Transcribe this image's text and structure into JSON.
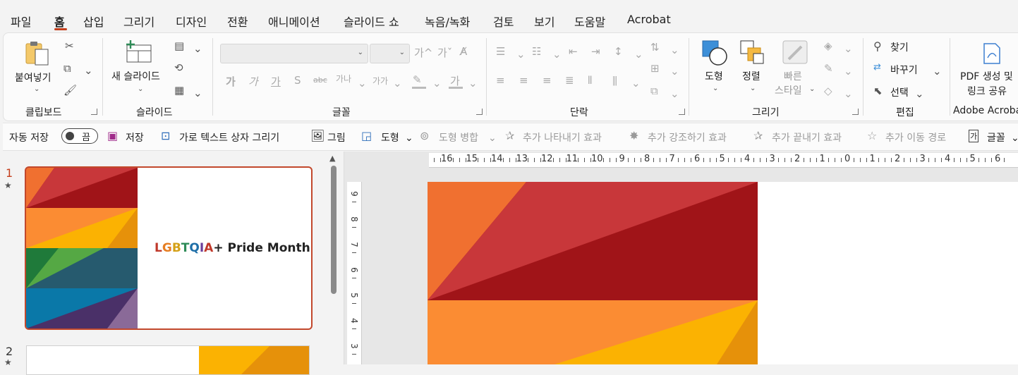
{
  "menu": {
    "tabs": [
      "파일",
      "홈",
      "삽입",
      "그리기",
      "디자인",
      "전환",
      "애니메이션",
      "슬라이드 쇼",
      "녹음/녹화",
      "검토",
      "보기",
      "도움말",
      "Acrobat"
    ],
    "active_tab": "홈"
  },
  "ribbon": {
    "clipboard": {
      "paste_label": "붙여넣기",
      "group_label": "클립보드"
    },
    "slides": {
      "new_slide_label": "새 슬라이드",
      "group_label": "슬라이드"
    },
    "font": {
      "group_label": "글꼴",
      "increase_font": "가^",
      "decrease_font": "가ˇ",
      "format_buttons": [
        "가",
        "가",
        "가",
        "S",
        "abc",
        "가나",
        "가가"
      ],
      "highlight_glyph": "가"
    },
    "paragraph": {
      "group_label": "단락"
    },
    "drawing": {
      "shapes_label": "도형",
      "arrange_label": "정렬",
      "quick_styles_label_1": "빠른",
      "quick_styles_label_2": "스타일",
      "group_label": "그리기"
    },
    "editing": {
      "find_label": "찾기",
      "replace_label": "바꾸기",
      "select_label": "선택",
      "group_label": "편집"
    },
    "adobe": {
      "pdf_label_1": "PDF 생성 및",
      "pdf_label_2": "링크 공유",
      "group_label": "Adobe Acrobat"
    }
  },
  "qat": {
    "autosave_label": "자동 저장",
    "autosave_state": "끔",
    "save_label": "저장",
    "text_box_label": "가로 텍스트 상자 그리기",
    "picture_label": "그림",
    "shapes_label": "도형",
    "merge_shapes_label": "도형 병합",
    "entrance_label": "추가 나타내기 효과",
    "emphasis_label": "추가 강조하기 효과",
    "exit_label": "추가 끝내기 효과",
    "motion_path_label": "추가 이동 경로",
    "font_label": "글꼴"
  },
  "thumbnails": {
    "slide1_number": "1",
    "slide1_title_letters": [
      {
        "t": "L",
        "c": "#c0392b"
      },
      {
        "t": "G",
        "c": "#e67e22"
      },
      {
        "t": "B",
        "c": "#d4a017"
      },
      {
        "t": "T",
        "c": "#2e8b57"
      },
      {
        "t": "Q",
        "c": "#1f6fa8"
      },
      {
        "t": "I",
        "c": "#6a3d9a"
      },
      {
        "t": "A",
        "c": "#c0392b"
      }
    ],
    "slide1_title_rest": "+ Pride Month",
    "slide2_number": "2"
  },
  "rulers": {
    "horizontal": [
      "16",
      "15",
      "14",
      "13",
      "12",
      "11",
      "10",
      "9",
      "8",
      "7",
      "6",
      "5",
      "4",
      "3",
      "2",
      "1",
      "0",
      "1",
      "2",
      "3",
      "4",
      "5",
      "6"
    ],
    "vertical": [
      "9",
      "8",
      "7",
      "6",
      "5",
      "4",
      "3"
    ]
  },
  "colors": {
    "accent": "#c43e1c",
    "orange_dark": "#f07030",
    "red": "#c8373a",
    "maroon": "#a01418",
    "orange": "#fb8c33",
    "yellow": "#fbb202",
    "amber": "#e6910a",
    "green_dark": "#1f7a3a",
    "green": "#55a844",
    "teal_dark": "#265a6e",
    "blue": "#0a78a8",
    "purple_dark": "#4a3068",
    "lavender": "#8a6a98"
  }
}
